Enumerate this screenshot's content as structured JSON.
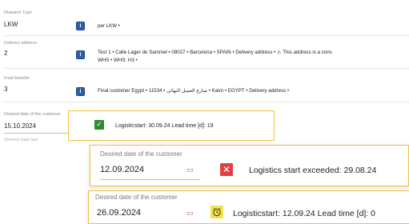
{
  "dispatch": {
    "label": "Dispatch Type",
    "value": "LKW",
    "text": "per LKW •"
  },
  "delivery": {
    "label": "Delivery address",
    "value": "2",
    "line1": "Test 1 • Calle Lager de Sammel • 08027 • Barcelona • SPAIN • Delivery address • ⚠ This address is a cons",
    "line2": "WHS • WHS: H3 •"
  },
  "final_transfer": {
    "label": "Final transfer",
    "value": "3",
    "text": "Final customer Egypt • 11534 • شارع العميل النهائي • Kairo • EGYPT • Delivery address •"
  },
  "desired_date_row": {
    "label": "Desired date of the customer",
    "value": "15.10.2024",
    "status": "Logisticstart: 30.09.24 Lead time [d]: 19",
    "hidden_label": "Delivery date last"
  },
  "panel_exceeded": {
    "label": "Desired date of the customer",
    "value": "12.09.2024",
    "status": "Logistics start exceeded: 29.08.24"
  },
  "panel_warning": {
    "label": "Desired date of the customer",
    "value": "26.09.2024",
    "status": "Logisticstart: 12.09.24 Lead time [d]: 0"
  },
  "colors": {
    "highlight_border": "#f0c040",
    "ok_green": "#2e8b2e",
    "error_red": "#e04040",
    "warn_yellow": "#f3e34a",
    "info_blue": "#2c5fa8"
  }
}
